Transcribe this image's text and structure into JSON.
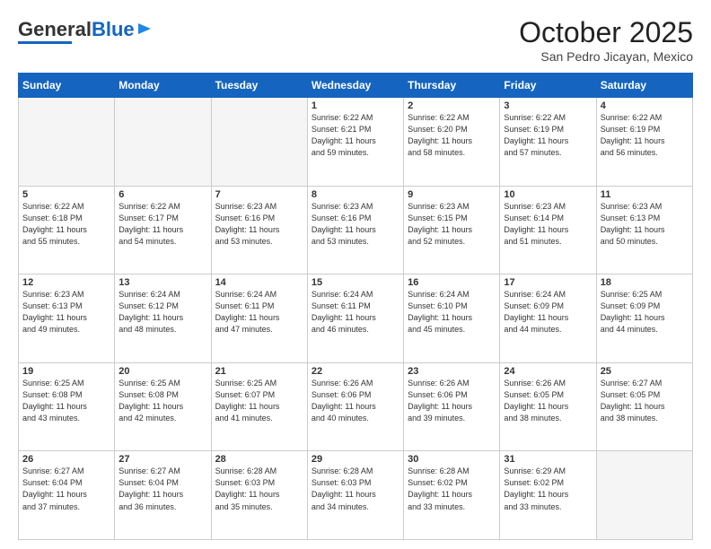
{
  "header": {
    "logo_general": "General",
    "logo_blue": "Blue",
    "month": "October 2025",
    "location": "San Pedro Jicayan, Mexico"
  },
  "weekdays": [
    "Sunday",
    "Monday",
    "Tuesday",
    "Wednesday",
    "Thursday",
    "Friday",
    "Saturday"
  ],
  "weeks": [
    [
      {
        "day": "",
        "info": ""
      },
      {
        "day": "",
        "info": ""
      },
      {
        "day": "",
        "info": ""
      },
      {
        "day": "1",
        "info": "Sunrise: 6:22 AM\nSunset: 6:21 PM\nDaylight: 11 hours\nand 59 minutes."
      },
      {
        "day": "2",
        "info": "Sunrise: 6:22 AM\nSunset: 6:20 PM\nDaylight: 11 hours\nand 58 minutes."
      },
      {
        "day": "3",
        "info": "Sunrise: 6:22 AM\nSunset: 6:19 PM\nDaylight: 11 hours\nand 57 minutes."
      },
      {
        "day": "4",
        "info": "Sunrise: 6:22 AM\nSunset: 6:19 PM\nDaylight: 11 hours\nand 56 minutes."
      }
    ],
    [
      {
        "day": "5",
        "info": "Sunrise: 6:22 AM\nSunset: 6:18 PM\nDaylight: 11 hours\nand 55 minutes."
      },
      {
        "day": "6",
        "info": "Sunrise: 6:22 AM\nSunset: 6:17 PM\nDaylight: 11 hours\nand 54 minutes."
      },
      {
        "day": "7",
        "info": "Sunrise: 6:23 AM\nSunset: 6:16 PM\nDaylight: 11 hours\nand 53 minutes."
      },
      {
        "day": "8",
        "info": "Sunrise: 6:23 AM\nSunset: 6:16 PM\nDaylight: 11 hours\nand 53 minutes."
      },
      {
        "day": "9",
        "info": "Sunrise: 6:23 AM\nSunset: 6:15 PM\nDaylight: 11 hours\nand 52 minutes."
      },
      {
        "day": "10",
        "info": "Sunrise: 6:23 AM\nSunset: 6:14 PM\nDaylight: 11 hours\nand 51 minutes."
      },
      {
        "day": "11",
        "info": "Sunrise: 6:23 AM\nSunset: 6:13 PM\nDaylight: 11 hours\nand 50 minutes."
      }
    ],
    [
      {
        "day": "12",
        "info": "Sunrise: 6:23 AM\nSunset: 6:13 PM\nDaylight: 11 hours\nand 49 minutes."
      },
      {
        "day": "13",
        "info": "Sunrise: 6:24 AM\nSunset: 6:12 PM\nDaylight: 11 hours\nand 48 minutes."
      },
      {
        "day": "14",
        "info": "Sunrise: 6:24 AM\nSunset: 6:11 PM\nDaylight: 11 hours\nand 47 minutes."
      },
      {
        "day": "15",
        "info": "Sunrise: 6:24 AM\nSunset: 6:11 PM\nDaylight: 11 hours\nand 46 minutes."
      },
      {
        "day": "16",
        "info": "Sunrise: 6:24 AM\nSunset: 6:10 PM\nDaylight: 11 hours\nand 45 minutes."
      },
      {
        "day": "17",
        "info": "Sunrise: 6:24 AM\nSunset: 6:09 PM\nDaylight: 11 hours\nand 44 minutes."
      },
      {
        "day": "18",
        "info": "Sunrise: 6:25 AM\nSunset: 6:09 PM\nDaylight: 11 hours\nand 44 minutes."
      }
    ],
    [
      {
        "day": "19",
        "info": "Sunrise: 6:25 AM\nSunset: 6:08 PM\nDaylight: 11 hours\nand 43 minutes."
      },
      {
        "day": "20",
        "info": "Sunrise: 6:25 AM\nSunset: 6:08 PM\nDaylight: 11 hours\nand 42 minutes."
      },
      {
        "day": "21",
        "info": "Sunrise: 6:25 AM\nSunset: 6:07 PM\nDaylight: 11 hours\nand 41 minutes."
      },
      {
        "day": "22",
        "info": "Sunrise: 6:26 AM\nSunset: 6:06 PM\nDaylight: 11 hours\nand 40 minutes."
      },
      {
        "day": "23",
        "info": "Sunrise: 6:26 AM\nSunset: 6:06 PM\nDaylight: 11 hours\nand 39 minutes."
      },
      {
        "day": "24",
        "info": "Sunrise: 6:26 AM\nSunset: 6:05 PM\nDaylight: 11 hours\nand 38 minutes."
      },
      {
        "day": "25",
        "info": "Sunrise: 6:27 AM\nSunset: 6:05 PM\nDaylight: 11 hours\nand 38 minutes."
      }
    ],
    [
      {
        "day": "26",
        "info": "Sunrise: 6:27 AM\nSunset: 6:04 PM\nDaylight: 11 hours\nand 37 minutes."
      },
      {
        "day": "27",
        "info": "Sunrise: 6:27 AM\nSunset: 6:04 PM\nDaylight: 11 hours\nand 36 minutes."
      },
      {
        "day": "28",
        "info": "Sunrise: 6:28 AM\nSunset: 6:03 PM\nDaylight: 11 hours\nand 35 minutes."
      },
      {
        "day": "29",
        "info": "Sunrise: 6:28 AM\nSunset: 6:03 PM\nDaylight: 11 hours\nand 34 minutes."
      },
      {
        "day": "30",
        "info": "Sunrise: 6:28 AM\nSunset: 6:02 PM\nDaylight: 11 hours\nand 33 minutes."
      },
      {
        "day": "31",
        "info": "Sunrise: 6:29 AM\nSunset: 6:02 PM\nDaylight: 11 hours\nand 33 minutes."
      },
      {
        "day": "",
        "info": ""
      }
    ]
  ]
}
